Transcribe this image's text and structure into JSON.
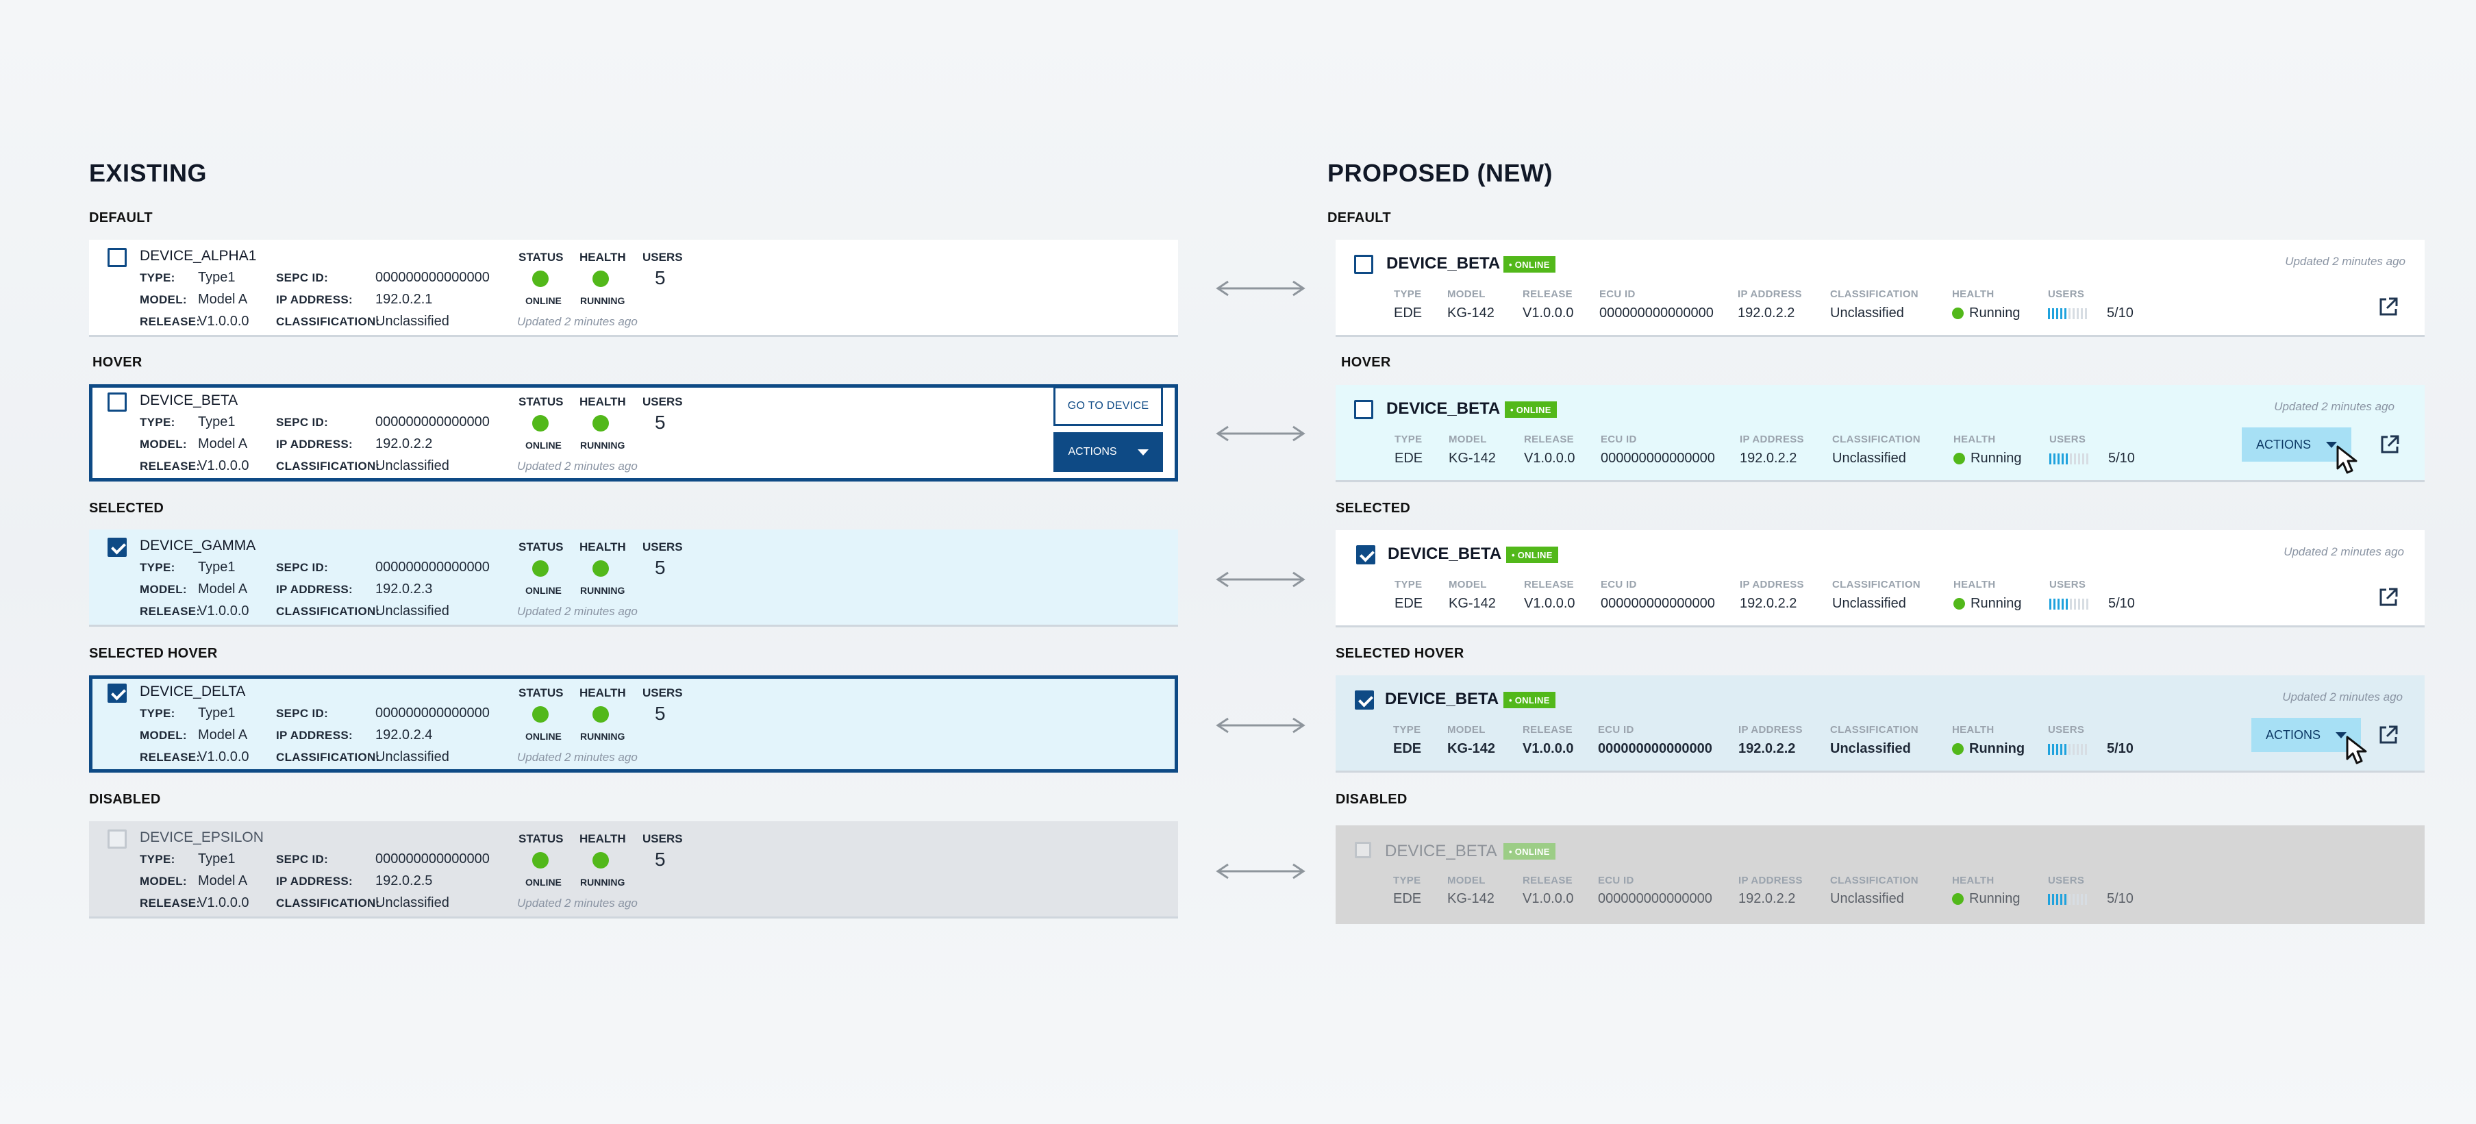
{
  "existing": {
    "title": "EXISTING",
    "labels": {
      "type": "TYPE:",
      "model": "MODEL:",
      "release": "RELEASE:",
      "sepc": "SEPC ID:",
      "ip": "IP ADDRESS:",
      "classification": "CLASSIFICATION:",
      "status": "STATUS",
      "health": "HEALTH",
      "users": "USERS",
      "online": "ONLINE",
      "running": "RUNNING"
    },
    "go_button": "GO TO DEVICE",
    "actions_button": "ACTIONS",
    "cards": [
      {
        "state": "DEFAULT",
        "name": "DEVICE_ALPHA1",
        "type": "Type1",
        "model": "Model A",
        "release": "V1.0.0.0",
        "sepc": "000000000000000",
        "ip": "192.0.2.1",
        "classification": "Unclassified",
        "users": "5",
        "updated": "Updated 2 minutes ago"
      },
      {
        "state": "HOVER",
        "name": "DEVICE_BETA",
        "type": "Type1",
        "model": "Model A",
        "release": "V1.0.0.0",
        "sepc": "000000000000000",
        "ip": "192.0.2.2",
        "classification": "Unclassified",
        "users": "5",
        "updated": "Updated 2 minutes ago"
      },
      {
        "state": "SELECTED",
        "name": "DEVICE_GAMMA",
        "type": "Type1",
        "model": "Model A",
        "release": "V1.0.0.0",
        "sepc": "000000000000000",
        "ip": "192.0.2.3",
        "classification": "Unclassified",
        "users": "5",
        "updated": "Updated 2 minutes ago"
      },
      {
        "state": "SELECTED HOVER",
        "name": "DEVICE_DELTA",
        "type": "Type1",
        "model": "Model A",
        "release": "V1.0.0.0",
        "sepc": "000000000000000",
        "ip": "192.0.2.4",
        "classification": "Unclassified",
        "users": "5",
        "updated": "Updated 2 minutes ago"
      },
      {
        "state": "DISABLED",
        "name": "DEVICE_EPSILON",
        "type": "Type1",
        "model": "Model A",
        "release": "V1.0.0.0",
        "sepc": "000000000000000",
        "ip": "192.0.2.5",
        "classification": "Unclassified",
        "users": "5",
        "updated": "Updated 2 minutes ago"
      }
    ]
  },
  "proposed": {
    "title": "PROPOSED (NEW)",
    "labels": {
      "type": "TYPE",
      "model": "MODEL",
      "release": "RELEASE",
      "ecu": "ECU ID",
      "ip": "IP ADDRESS",
      "classification": "CLASSIFICATION",
      "health": "HEALTH",
      "users": "USERS"
    },
    "badge": "• ONLINE",
    "actions_button": "ACTIONS",
    "cards": [
      {
        "state": "DEFAULT",
        "name": "DEVICE_BETA",
        "type": "EDE",
        "model": "KG-142",
        "release": "V1.0.0.0",
        "ecu": "000000000000000",
        "ip": "192.0.2.2",
        "classification": "Unclassified",
        "health": "Running",
        "users": "5/10",
        "users_fraction": 0.5,
        "updated": "Updated 2 minutes ago"
      },
      {
        "state": "HOVER",
        "name": "DEVICE_BETA",
        "type": "EDE",
        "model": "KG-142",
        "release": "V1.0.0.0",
        "ecu": "000000000000000",
        "ip": "192.0.2.2",
        "classification": "Unclassified",
        "health": "Running",
        "users": "5/10",
        "users_fraction": 0.5,
        "updated": "Updated 2 minutes ago"
      },
      {
        "state": "SELECTED",
        "name": "DEVICE_BETA",
        "type": "EDE",
        "model": "KG-142",
        "release": "V1.0.0.0",
        "ecu": "000000000000000",
        "ip": "192.0.2.2",
        "classification": "Unclassified",
        "health": "Running",
        "users": "5/10",
        "users_fraction": 0.5,
        "updated": "Updated 2 minutes ago"
      },
      {
        "state": "SELECTED HOVER",
        "name": "DEVICE_BETA",
        "type": "EDE",
        "model": "KG-142",
        "release": "V1.0.0.0",
        "ecu": "000000000000000",
        "ip": "192.0.2.2",
        "classification": "Unclassified",
        "health": "Running",
        "users": "5/10",
        "users_fraction": 0.5,
        "updated": "Updated 2 minutes ago"
      },
      {
        "state": "DISABLED",
        "name": "DEVICE_BETA",
        "type": "EDE",
        "model": "KG-142",
        "release": "V1.0.0.0",
        "ecu": "000000000000000",
        "ip": "192.0.2.2",
        "classification": "Unclassified",
        "health": "Running",
        "users": "5/10",
        "users_fraction": 0.5,
        "updated": ""
      }
    ]
  },
  "colors": {
    "brand": "#0e4a85",
    "online_green": "#52b81a",
    "selected_bg": "#e3f4fb",
    "users_bar": "#1fa2dd",
    "disabled_bg": "#d6d6d6"
  },
  "icons": [
    "checkbox-icon",
    "status-dot-icon",
    "caret-down-icon",
    "external-link-icon",
    "double-arrow-icon",
    "mouse-cursor-icon"
  ]
}
